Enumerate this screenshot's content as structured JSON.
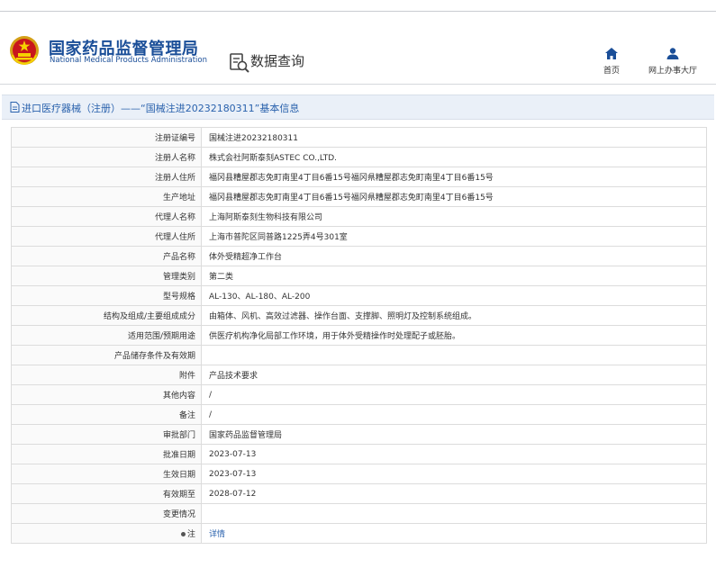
{
  "header": {
    "site_name_cn": "国家药品监督管理局",
    "site_name_en": "National Medical Products Administration",
    "query_label": "数据查询",
    "nav": [
      {
        "label": "首页",
        "icon": "home-icon"
      },
      {
        "label": "网上办事大厅",
        "icon": "user-icon"
      }
    ]
  },
  "title_bar": {
    "text": "进口医疗器械（注册）——“国械注进20232180311”基本信息"
  },
  "colors": {
    "brand_blue": "#1a4e98",
    "link_blue": "#2a62ad",
    "title_bg": "#eaf0f8"
  },
  "details": [
    {
      "label": "注册证编号",
      "value": "国械注进20232180311"
    },
    {
      "label": "注册人名称",
      "value": "株式会社阿斯泰刻ASTEC CO.,LTD."
    },
    {
      "label": "注册人住所",
      "value": "福冈县糟屋郡志免町南里4丁目6番15号福冈県糟屋郡志免町南里4丁目6番15号"
    },
    {
      "label": "生产地址",
      "value": "福冈县糟屋郡志免町南里4丁目6番15号福冈県糟屋郡志免町南里4丁目6番15号"
    },
    {
      "label": "代理人名称",
      "value": "上海阿斯泰刻生物科技有限公司"
    },
    {
      "label": "代理人住所",
      "value": "上海市普陀区同普路1225弄4号301室"
    },
    {
      "label": "产品名称",
      "value": "体外受精超净工作台"
    },
    {
      "label": "管理类别",
      "value": "第二类"
    },
    {
      "label": "型号规格",
      "value": "AL-130、AL-180、AL-200"
    },
    {
      "label": "结构及组成/主要组成成分",
      "value": "由箱体、风机、高效过滤器、操作台面、支撑脚、照明灯及控制系统组成。"
    },
    {
      "label": "适用范围/预期用途",
      "value": "供医疗机构净化局部工作环境，用于体外受精操作时处理配子或胚胎。"
    },
    {
      "label": "产品储存条件及有效期",
      "value": ""
    },
    {
      "label": "附件",
      "value": "产品技术要求"
    },
    {
      "label": "其他内容",
      "value": "/"
    },
    {
      "label": "备注",
      "value": "/"
    },
    {
      "label": "审批部门",
      "value": "国家药品监督管理局"
    },
    {
      "label": "批准日期",
      "value": "2023-07-13"
    },
    {
      "label": "生效日期",
      "value": "2023-07-13"
    },
    {
      "label": "有效期至",
      "value": "2028-07-12"
    },
    {
      "label": "变更情况",
      "value": ""
    },
    {
      "label": "注",
      "value": "详情",
      "link": true
    }
  ]
}
